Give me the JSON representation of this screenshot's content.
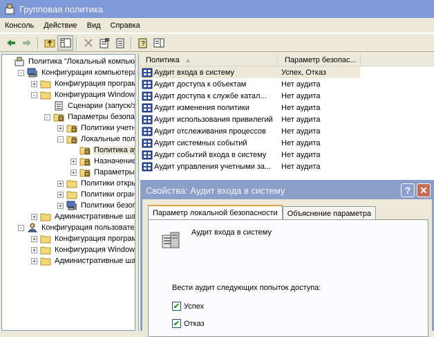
{
  "window": {
    "title": "Групповая политика"
  },
  "menu": [
    "Консоль",
    "Действие",
    "Вид",
    "Справка"
  ],
  "tree": {
    "items": [
      {
        "label": "Политика \"Локальный компьюте",
        "indent": 0,
        "exp": "",
        "icon": "policy-icon"
      },
      {
        "label": "Конфигурация компьютера",
        "indent": 1,
        "exp": "-",
        "icon": "computer-icon"
      },
      {
        "label": "Конфигурация программ",
        "indent": 2,
        "exp": "+",
        "icon": "folder-icon"
      },
      {
        "label": "Конфигурация Windows",
        "indent": 2,
        "exp": "-",
        "icon": "folder-icon"
      },
      {
        "label": "Сценарии (запуск/заве",
        "indent": 3,
        "exp": "",
        "icon": "script-icon"
      },
      {
        "label": "Параметры безопаснос",
        "indent": 3,
        "exp": "-",
        "icon": "lock-folder-icon"
      },
      {
        "label": "Политики учетны",
        "indent": 4,
        "exp": "+",
        "icon": "lock-folder-icon"
      },
      {
        "label": "Локальные полит",
        "indent": 4,
        "exp": "-",
        "icon": "lock-folder-icon"
      },
      {
        "label": "Политика ауд",
        "indent": 5,
        "exp": "",
        "icon": "lock-folder-icon",
        "selected": true
      },
      {
        "label": "Назначение пр",
        "indent": 5,
        "exp": "+",
        "icon": "lock-folder-icon"
      },
      {
        "label": "Параметры бе",
        "indent": 5,
        "exp": "+",
        "icon": "lock-folder-icon"
      },
      {
        "label": "Политики открыт",
        "indent": 4,
        "exp": "+",
        "icon": "folder-icon"
      },
      {
        "label": "Политики огранич",
        "indent": 4,
        "exp": "+",
        "icon": "folder-icon"
      },
      {
        "label": "Политики безопас",
        "indent": 4,
        "exp": "+",
        "icon": "computer-icon"
      },
      {
        "label": "Административные шабл",
        "indent": 2,
        "exp": "+",
        "icon": "folder-icon"
      },
      {
        "label": "Конфигурация пользователя",
        "indent": 1,
        "exp": "-",
        "icon": "user-icon"
      },
      {
        "label": "Конфигурация программ",
        "indent": 2,
        "exp": "+",
        "icon": "folder-icon"
      },
      {
        "label": "Конфигурация Windows",
        "indent": 2,
        "exp": "+",
        "icon": "folder-icon"
      },
      {
        "label": "Административные шабл",
        "indent": 2,
        "exp": "+",
        "icon": "folder-icon"
      }
    ]
  },
  "list": {
    "columns": [
      "Политика",
      "Параметр безопас..."
    ],
    "rows": [
      {
        "policy": "Аудит входа в систему",
        "value": "Успех, Отказ",
        "selected": true
      },
      {
        "policy": "Аудит доступа к объектам",
        "value": "Нет аудита"
      },
      {
        "policy": "Аудит доступа к службе катал...",
        "value": "Нет аудита"
      },
      {
        "policy": "Аудит изменения политики",
        "value": "Нет аудита"
      },
      {
        "policy": "Аудит использования привилегий",
        "value": "Нет аудита"
      },
      {
        "policy": "Аудит отслеживания процессов",
        "value": "Нет аудита"
      },
      {
        "policy": "Аудит системных событий",
        "value": "Нет аудита"
      },
      {
        "policy": "Аудит событий входа в систему",
        "value": "Нет аудита"
      },
      {
        "policy": "Аудит управления учетными за...",
        "value": "Нет аудита"
      }
    ]
  },
  "dialog": {
    "title": "Свойства: Аудит входа в систему",
    "help": "?",
    "close": "✕",
    "tabs": [
      "Параметр локальной безопасности",
      "Объяснение параметра"
    ],
    "policy_name": "Аудит входа в систему",
    "audit_question": "Вести аудит следующих попыток доступа:",
    "success_label": "Успех",
    "success_checked": true,
    "failure_label": "Отказ",
    "failure_checked": true
  }
}
